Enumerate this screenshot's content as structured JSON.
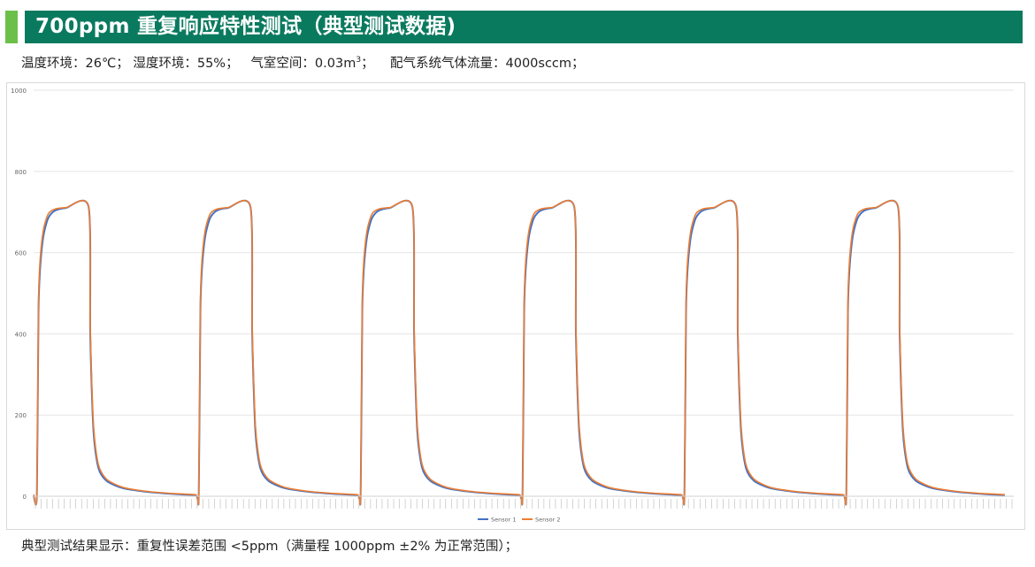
{
  "header": {
    "title": "700ppm 重复响应特性测试（典型测试数据)",
    "accent_color": "#6cc04a",
    "bar_color": "#0a7a5f"
  },
  "conditions": {
    "temperature": "温度环境：26℃；",
    "humidity": "湿度环境：55%；",
    "chamber_prefix": "气室空间：0.03m",
    "chamber_sup": "3",
    "chamber_suffix": "；",
    "flow": "配气系统气体流量：4000sccm；"
  },
  "footer": {
    "result": "典型测试结果显示：重复性误差范围 <5ppm（满量程 1000ppm ±2% 为正常范围）；"
  },
  "chart_data": {
    "type": "line",
    "title": "",
    "xlabel": "",
    "ylabel": "",
    "ylim": [
      0,
      1000
    ],
    "yticks": [
      "0",
      "200",
      "400",
      "600",
      "800",
      "1000"
    ],
    "grid": true,
    "legend_position": "bottom",
    "series": [
      {
        "name": "Sensor 1",
        "color": "#4472c4"
      },
      {
        "name": "Sensor 2",
        "color": "#ed7d31"
      }
    ],
    "baseline_ppm": 3,
    "plateau_ppm": 712,
    "cycles": 6,
    "cycle_pattern": [
      {
        "t": 0,
        "s1": 3,
        "s2": 4
      },
      {
        "t": 0.02,
        "s1": 3,
        "s2": 4
      },
      {
        "t": 0.03,
        "s1": 450,
        "s2": 470
      },
      {
        "t": 0.04,
        "s1": 560,
        "s2": 580
      },
      {
        "t": 0.06,
        "s1": 640,
        "s2": 655
      },
      {
        "t": 0.09,
        "s1": 685,
        "s2": 695
      },
      {
        "t": 0.13,
        "s1": 703,
        "s2": 707
      },
      {
        "t": 0.2,
        "s1": 710,
        "s2": 711
      },
      {
        "t": 0.34,
        "s1": 712,
        "s2": 713
      },
      {
        "t": 0.35,
        "s1": 400,
        "s2": 420
      },
      {
        "t": 0.37,
        "s1": 160,
        "s2": 175
      },
      {
        "t": 0.4,
        "s1": 70,
        "s2": 78
      },
      {
        "t": 0.45,
        "s1": 38,
        "s2": 42
      },
      {
        "t": 0.55,
        "s1": 20,
        "s2": 22
      },
      {
        "t": 0.7,
        "s1": 11,
        "s2": 12
      },
      {
        "t": 0.85,
        "s1": 6,
        "s2": 7
      },
      {
        "t": 1.0,
        "s1": 3,
        "s2": 4
      }
    ]
  }
}
